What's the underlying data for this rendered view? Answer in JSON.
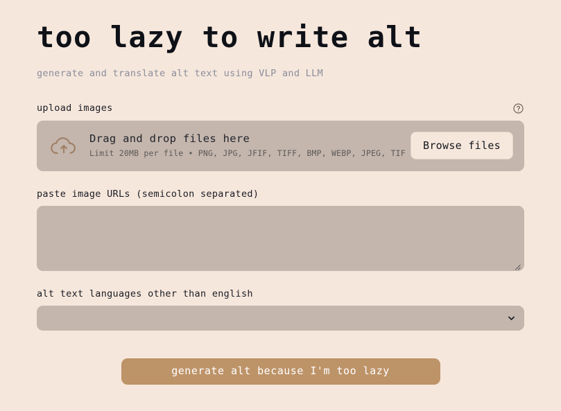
{
  "header": {
    "title": "too lazy to write alt",
    "subtitle": "generate and translate alt text using VLP and LLM"
  },
  "upload": {
    "label": "upload images",
    "help_icon": "question-circle-icon",
    "cloud_icon": "cloud-upload-icon",
    "dropzone_title": "Drag and drop files here",
    "dropzone_hint": "Limit 20MB per file • PNG, JPG, JFIF, TIFF, BMP, WEBP, JPEG, TIF",
    "browse_label": "Browse files"
  },
  "urls": {
    "label": "paste image URLs (semicolon separated)",
    "value": "",
    "placeholder": ""
  },
  "languages": {
    "label": "alt text languages other than english",
    "selected": "",
    "placeholder": "",
    "chevron_icon": "chevron-down-icon"
  },
  "submit": {
    "label": "generate alt because I'm too lazy"
  },
  "colors": {
    "page_background": "#f6e7dc",
    "input_background": "#c4b6ad",
    "accent_button": "#bd9368",
    "icon_accent": "#9e7f63",
    "subtitle_text": "#8a8d9c",
    "primary_text": "#0e1117"
  }
}
